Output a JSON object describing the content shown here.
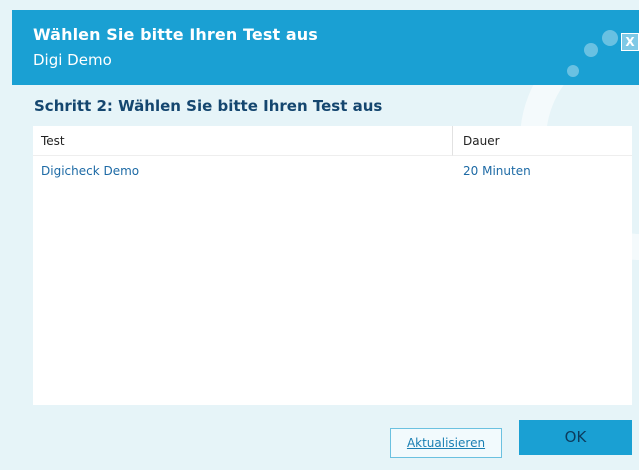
{
  "header": {
    "title": "Wählen Sie bitte Ihren Test aus",
    "subtitle": "Digi  Demo"
  },
  "close_glyph": "X",
  "step": {
    "title": "Schritt 2: Wählen Sie bitte Ihren Test aus"
  },
  "table": {
    "columns": [
      "Test",
      "Dauer"
    ],
    "rows": [
      {
        "test": "Digicheck Demo",
        "dauer": "20 Minuten"
      }
    ]
  },
  "buttons": {
    "refresh_label": "Aktualisieren",
    "ok_label": "OK"
  },
  "colors": {
    "accent": "#1aa0d3",
    "background": "#e6f4f8",
    "link": "#1d6aa5",
    "heading": "#14466f"
  }
}
